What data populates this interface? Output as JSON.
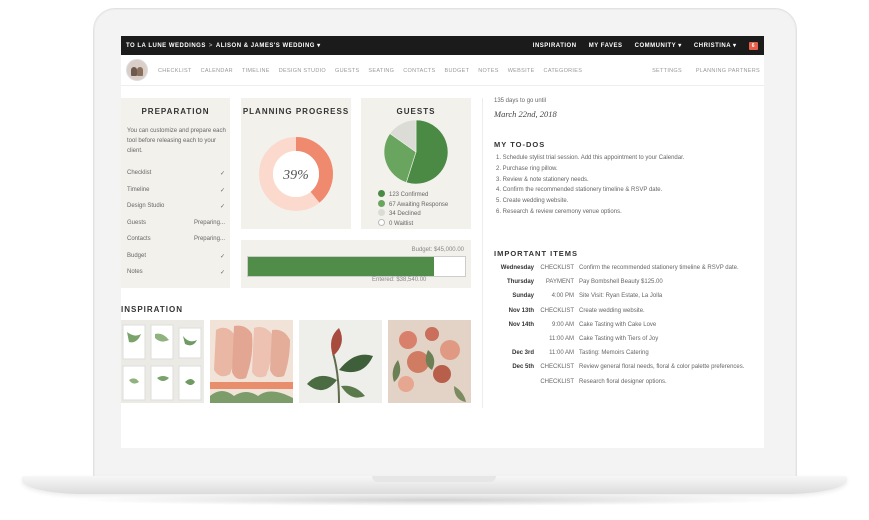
{
  "topbar": {
    "org": "TO LA LUNE WEDDINGS",
    "separator": ">",
    "event": "ALISON & JAMES'S WEDDING ▾",
    "inspiration": "INSPIRATION",
    "faves": "MY FAVES",
    "community": "COMMUNITY ▾",
    "user": "CHRISTINA ▾",
    "notifications": "6"
  },
  "subnav": {
    "items": [
      "CHECKLIST",
      "CALENDAR",
      "TIMELINE",
      "DESIGN STUDIO",
      "GUESTS",
      "SEATING",
      "CONTACTS",
      "BUDGET",
      "NOTES",
      "WEBSITE",
      "CATEGORIES"
    ],
    "settings": "SETTINGS",
    "partners": "PLANNING PARTNERS"
  },
  "preparation": {
    "title": "PREPARATION",
    "description": "You can customize and prepare each tool before releasing each to your client.",
    "rows": [
      {
        "label": "Checklist",
        "status": "✓"
      },
      {
        "label": "Timeline",
        "status": "✓"
      },
      {
        "label": "Design Studio",
        "status": "✓"
      },
      {
        "label": "Guests",
        "status": "Preparing..."
      },
      {
        "label": "Contacts",
        "status": "Preparing..."
      },
      {
        "label": "Budget",
        "status": "✓"
      },
      {
        "label": "Notes",
        "status": "✓"
      }
    ]
  },
  "progress": {
    "title": "PLANNING PROGRESS",
    "value": "39%",
    "fraction": 0.39
  },
  "guests": {
    "title": "GUESTS",
    "legend": [
      {
        "label": "123 Confirmed",
        "count": 123,
        "color": "#4a8a44"
      },
      {
        "label": "67 Awaiting Response",
        "count": 67,
        "color": "#6aa55f"
      },
      {
        "label": "34 Declined",
        "count": 34,
        "color": "#dcdcd6"
      },
      {
        "label": "0 Waitlist",
        "count": 0,
        "color": "#ffffff"
      }
    ]
  },
  "budget": {
    "budget_label": "Budget: $45,000.00",
    "entered_label": "Entered: $38,540.00",
    "fraction": 0.8564
  },
  "inspiration": {
    "title": "INSPIRATION"
  },
  "countdown": {
    "days": "135 days to go until",
    "date": "March 22nd, 2018"
  },
  "todos": {
    "title": "MY TO-DOS",
    "items": [
      "1. Schedule stylist trial session. Add this appointment to your Calendar.",
      "2. Purchase ring pillow.",
      "3. Review & note stationery needs.",
      "4. Confirm the recommended stationery timeline & RSVP date.",
      "5. Create wedding website.",
      "6. Research & review ceremony venue options."
    ]
  },
  "important": {
    "title": "IMPORTANT ITEMS",
    "rows": [
      {
        "day": "Wednesday",
        "type": "CHECKLIST",
        "text": "Confirm the recommended stationery timeline & RSVP date."
      },
      {
        "day": "Thursday",
        "type": "PAYMENT",
        "text": "Pay Bombshell Beauty $125.00"
      },
      {
        "day": "Sunday",
        "type": "4:00 PM",
        "text": "Site Visit: Ryan Estate, La Jolla"
      },
      {
        "day": "Nov 13th",
        "type": "CHECKLIST",
        "text": "Create wedding website."
      },
      {
        "day": "Nov 14th",
        "type": "9:00 AM",
        "text": "Cake Tasting with Cake Love"
      },
      {
        "day": "",
        "type": "11:00 AM",
        "text": "Cake Tasting with Tiers of Joy"
      },
      {
        "day": "Dec 3rd",
        "type": "11:00 AM",
        "text": "Tasting: Memoirs Catering"
      },
      {
        "day": "Dec 5th",
        "type": "CHECKLIST",
        "text": "Review general floral needs, floral & color palette preferences."
      },
      {
        "day": "",
        "type": "CHECKLIST",
        "text": "Research floral designer options."
      }
    ]
  },
  "colors": {
    "accent": "#f08a6e",
    "green": "#4f8d49",
    "panel": "#f2f1ec",
    "topbar": "#1b1b1b",
    "badge": "#e8604c"
  }
}
